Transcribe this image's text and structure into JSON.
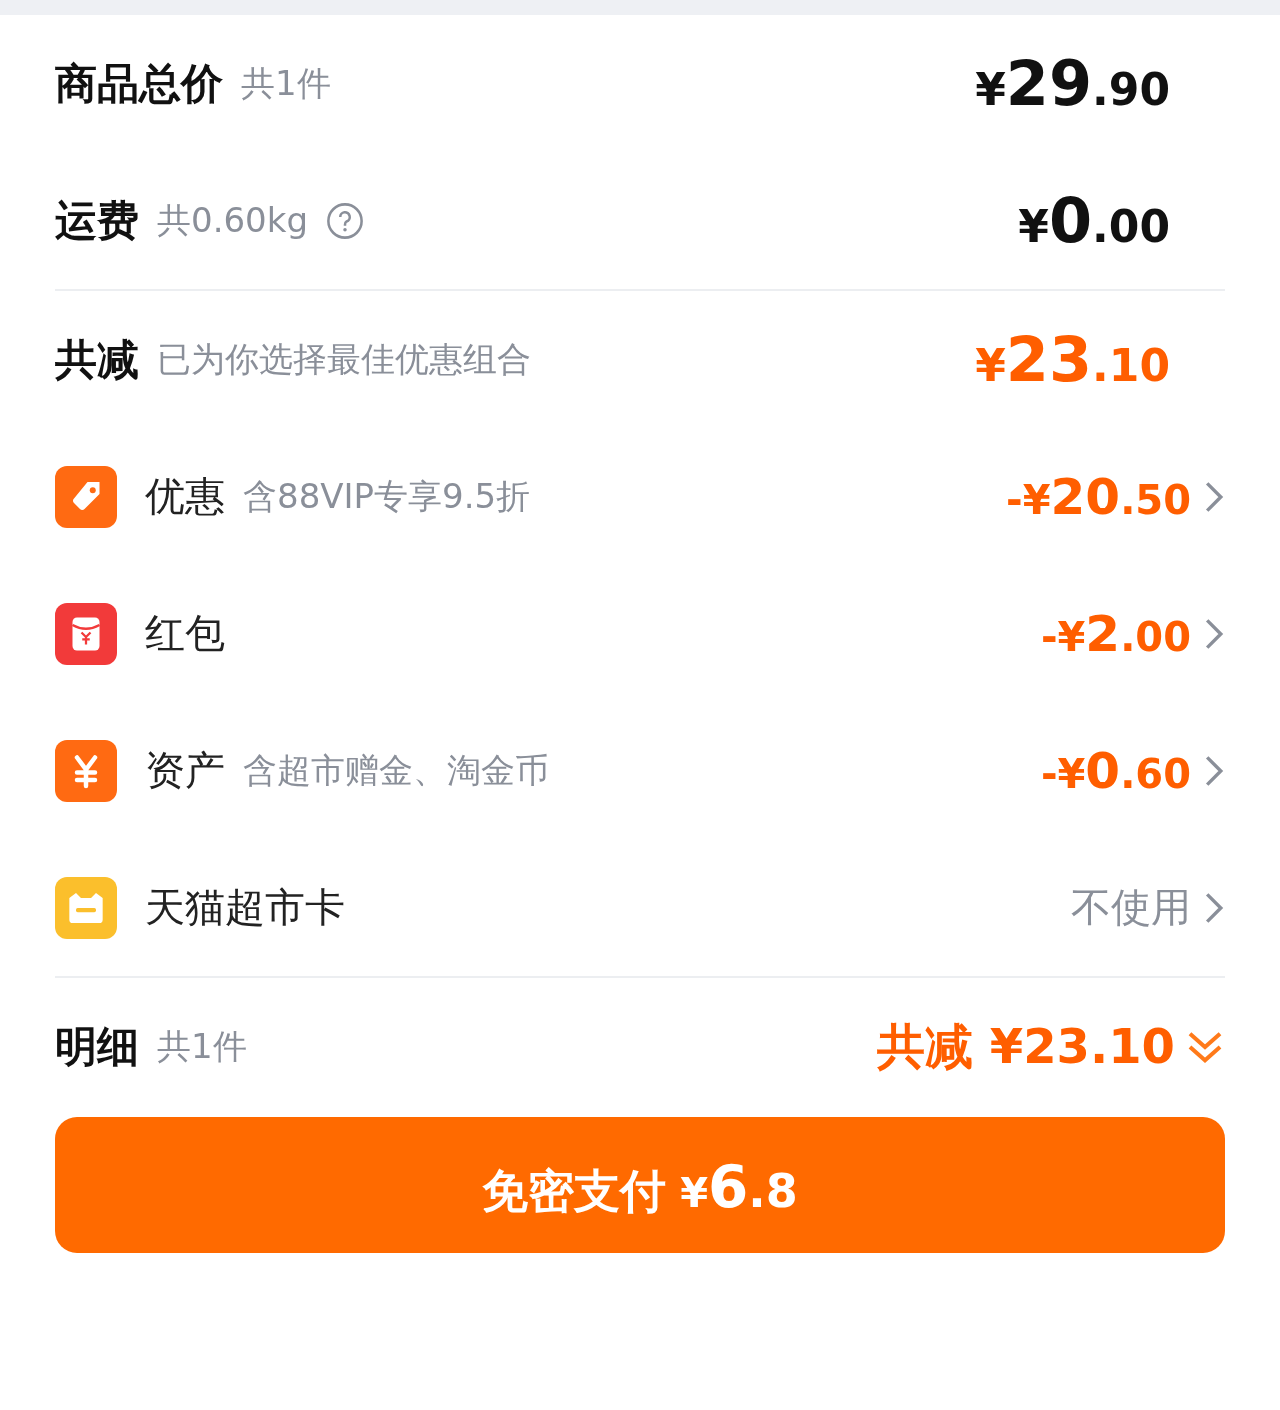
{
  "summary": [
    {
      "label": "商品总价",
      "note": "共1件",
      "help": false,
      "price": {
        "sign": "¥",
        "whole": "29",
        "fraction": ".90"
      }
    },
    {
      "label": "运费",
      "note": "共0.60kg",
      "help": true,
      "price": {
        "sign": "¥",
        "whole": "0",
        "fraction": ".00"
      }
    }
  ],
  "discount_total": {
    "label": "共减",
    "note": "已为你选择最佳优惠组合",
    "price": {
      "sign": "¥",
      "whole": "23",
      "fraction": ".10"
    }
  },
  "discounts": [
    {
      "kind": "tag",
      "color": "#ff6a12",
      "label": "优惠",
      "note": "含88VIP专享9.5折",
      "price": {
        "sign": "-¥",
        "whole": "20",
        "fraction": ".50"
      }
    },
    {
      "kind": "envelope",
      "color": "#f23a3a",
      "label": "红包",
      "price": {
        "sign": "-¥",
        "whole": "2",
        "fraction": ".00"
      }
    },
    {
      "kind": "yuan",
      "color": "#ff6a12",
      "label": "资产",
      "note": "含超市赠金、淘金币",
      "price": {
        "sign": "-¥",
        "whole": "0",
        "fraction": ".60"
      }
    },
    {
      "kind": "card",
      "color": "#fbbf2c",
      "label": "天猫超市卡",
      "status": "不使用"
    }
  ],
  "detail": {
    "label": "明细",
    "note": "共1件",
    "summary": "共减 ¥23.10",
    "expanded": false
  },
  "pay_button": {
    "label": "免密支付",
    "sign": "¥",
    "whole": "6",
    "fraction": ".8"
  }
}
